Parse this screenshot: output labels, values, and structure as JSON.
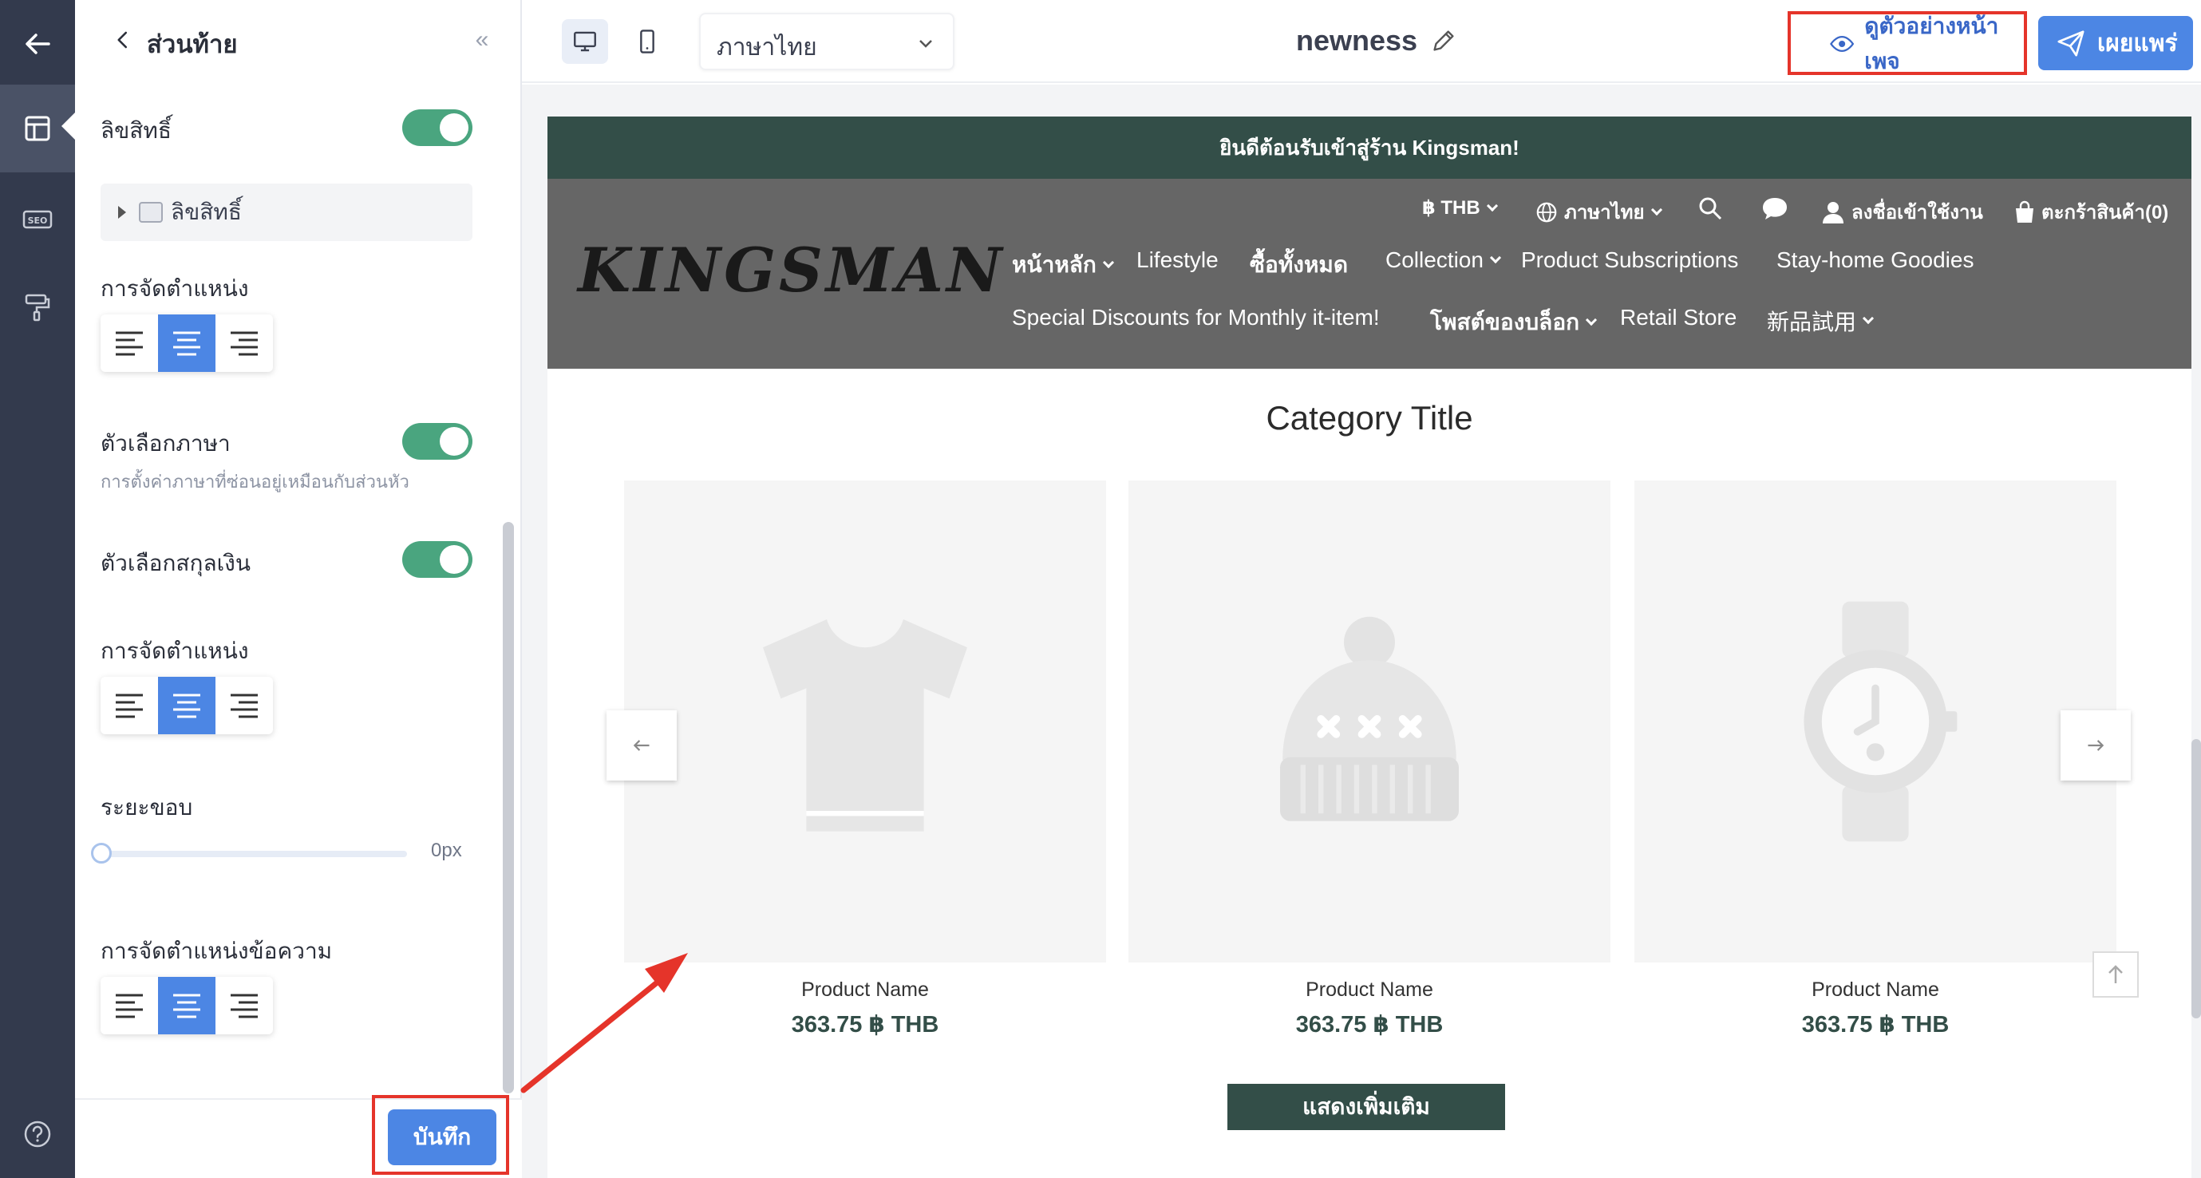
{
  "panel": {
    "title": "ส่วนท้าย",
    "collapse_glyph": "«",
    "copyright_label": "ลิขสิทธิ์",
    "copyright_item": "ลิขสิทธิ์",
    "alignment_label_1": "การจัดตำแหน่ง",
    "language_selector_label": "ตัวเลือกภาษา",
    "language_selector_note": "การตั้งค่าภาษาที่ซ่อนอยู่เหมือนกับส่วนหัว",
    "currency_selector_label": "ตัวเลือกสกุลเงิน",
    "alignment_label_2": "การจัดตำแหน่ง",
    "padding_label": "ระยะขอบ",
    "padding_value": "0px",
    "text_alignment_label": "การจัดตำแหน่งข้อความ",
    "save_label": "บันทึก"
  },
  "toggles": {
    "copyright": true,
    "language_selector": true,
    "currency_selector": true
  },
  "topbar": {
    "language": "ภาษาไทย",
    "page_name": "newness",
    "preview_label": "ดูตัวอย่างหน้าเพจ",
    "publish_label": "เผยแพร่"
  },
  "site": {
    "announcement": "ยินดีต้อนรับเข้าสู่ร้าน Kingsman!",
    "logo": "KINGSMAN",
    "util": {
      "currency": "฿ THB",
      "language": "ภาษาไทย",
      "login": "ลงชื่อเข้าใช้งาน",
      "cart": "ตะกร้าสินค้า(0)"
    },
    "nav_row1": [
      "หน้าหลัก",
      "Lifestyle",
      "ซื้อทั้งหมด",
      "Collection",
      "Product Subscriptions",
      "Stay-home Goodies"
    ],
    "nav_row2": [
      "Special Discounts for Monthly it-item!",
      "โพสต์ของบล็อก",
      "Retail Store",
      "新品試用"
    ],
    "category_title": "Category Title",
    "products": [
      {
        "name": "Product Name",
        "price": "363.75 ฿ THB",
        "icon": "tshirt-icon"
      },
      {
        "name": "Product Name",
        "price": "363.75 ฿ THB",
        "icon": "beanie-icon"
      },
      {
        "name": "Product Name",
        "price": "363.75 ฿ THB",
        "icon": "watch-icon"
      }
    ],
    "show_more": "แสดงเพิ่มเติม"
  },
  "colors": {
    "rail": "#333a4d",
    "accent": "#4c86e4",
    "toggle_on": "#4aa57f",
    "brand_dark_green": "#334e48",
    "header_gray": "#666666",
    "highlight_red": "#e5342a"
  }
}
